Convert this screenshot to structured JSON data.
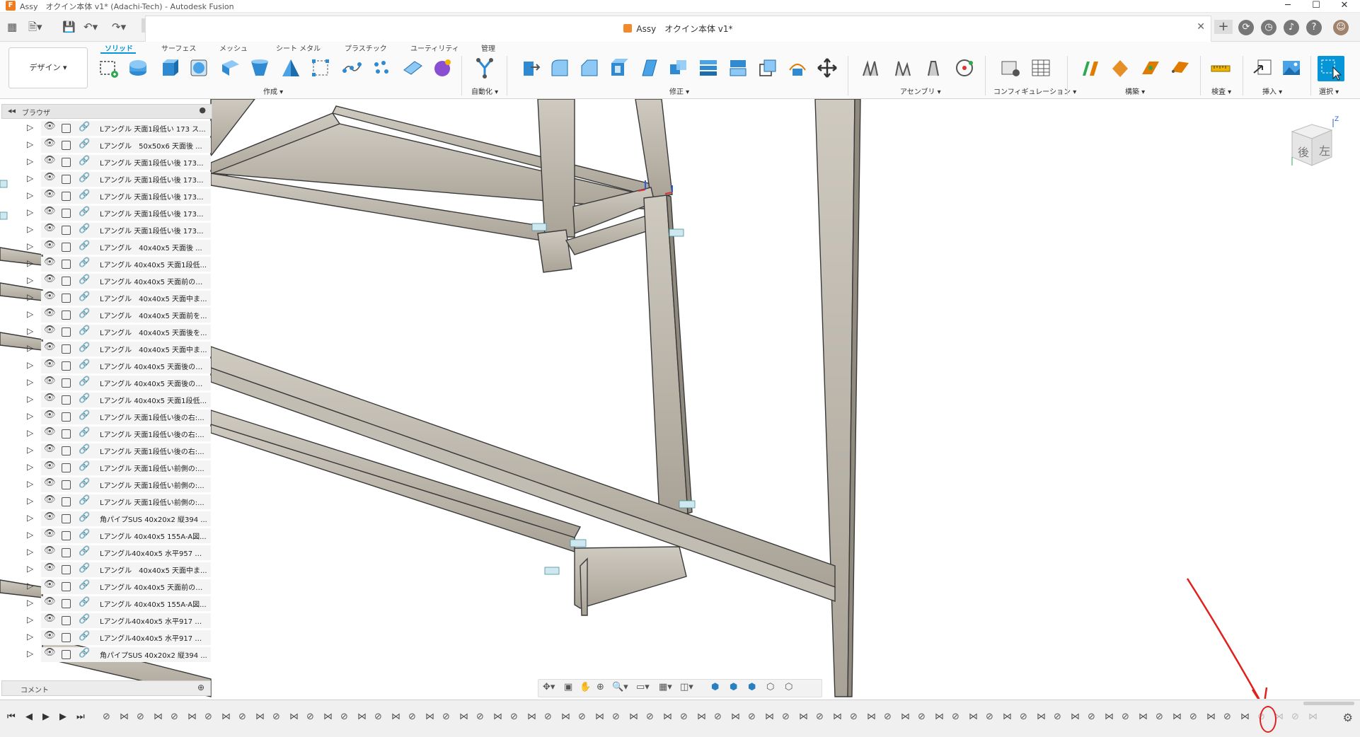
{
  "window": {
    "title": "Assy　オクイン本体 v1* (Adachi-Tech) - Autodesk Fusion",
    "controls": [
      "─",
      "☐",
      "✕"
    ]
  },
  "doc_tab": {
    "title": "Assy　オクイン本体 v1*",
    "close": "✕"
  },
  "workspace": {
    "label": "デザイン ▾"
  },
  "ribbon": {
    "tabs": [
      {
        "label": "ソリッド",
        "active": true
      },
      {
        "label": "サーフェス"
      },
      {
        "label": "メッシュ"
      },
      {
        "label": "シート メタル"
      },
      {
        "label": "プラスチック"
      },
      {
        "label": "ユーティリティ"
      },
      {
        "label": "管理"
      }
    ],
    "groups": [
      {
        "label": "作成 ▾"
      },
      {
        "label": "自動化 ▾"
      },
      {
        "label": "修正 ▾"
      },
      {
        "label": "アセンブリ ▾"
      },
      {
        "label": "コンフィギュレーション ▾"
      },
      {
        "label": "構築 ▾"
      },
      {
        "label": "検査 ▾"
      },
      {
        "label": "挿入 ▾"
      },
      {
        "label": "選択 ▾"
      }
    ],
    "accent": "#0696d7"
  },
  "browser": {
    "title": "ブラウザ",
    "items": [
      {
        "label": "Lアングル 天面1段低い 173 ス..."
      },
      {
        "label": "Lアングル　50x50x6 天面後 ..."
      },
      {
        "label": "Lアングル 天面1段低い後 173..."
      },
      {
        "label": "Lアングル 天面1段低い後 173..."
      },
      {
        "label": "Lアングル 天面1段低い後 173..."
      },
      {
        "label": "Lアングル 天面1段低い後 173..."
      },
      {
        "label": "Lアングル 天面1段低い後 173..."
      },
      {
        "label": "Lアングル　40x40x5 天面後 ..."
      },
      {
        "label": "Lアングル 40x40x5 天面1段低..."
      },
      {
        "label": "Lアングル 40x40x5 天面前の右..."
      },
      {
        "label": "Lアングル　40x40x5 天面中ま..."
      },
      {
        "label": "Lアングル　40x40x5 天面前を..."
      },
      {
        "label": "Lアングル　40x40x5 天面後を..."
      },
      {
        "label": "Lアングル　40x40x5 天面中ま..."
      },
      {
        "label": "Lアングル 40x40x5 天面後の右..."
      },
      {
        "label": "Lアングル 40x40x5 天面後の右..."
      },
      {
        "label": "Lアングル 40x40x5 天面1段低..."
      },
      {
        "label": "Lアングル 天面1段低い後の右:..."
      },
      {
        "label": "Lアングル 天面1段低い後の右:..."
      },
      {
        "label": "Lアングル 天面1段低い後の右:..."
      },
      {
        "label": "Lアングル 天面1段低い前側の:..."
      },
      {
        "label": "Lアングル 天面1段低い前側の:..."
      },
      {
        "label": "Lアングル 天面1段低い前側の:..."
      },
      {
        "label": "角パイプSUS 40x20x2 縦394 ..."
      },
      {
        "label": "Lアングル 40x40x5 155A-A図..."
      },
      {
        "label": "Lアングル40x40x5 水平957 ス..."
      },
      {
        "label": "Lアングル　40x40x5 天面中ま..."
      },
      {
        "label": "Lアングル 40x40x5 天面前の右..."
      },
      {
        "label": "Lアングル 40x40x5 155A-A図..."
      },
      {
        "label": "Lアングル40x40x5 水平917 M..."
      },
      {
        "label": "Lアングル40x40x5 水平917 M..."
      },
      {
        "label": "角パイプSUS 40x20x2 縦394 ..."
      }
    ]
  },
  "comments": {
    "title": "コメント"
  },
  "viewcube": {
    "face_back": "後",
    "face_left": "左",
    "axis_z": "Z"
  },
  "timeline": {
    "feature_count": 72,
    "marker": "#e0201c"
  }
}
